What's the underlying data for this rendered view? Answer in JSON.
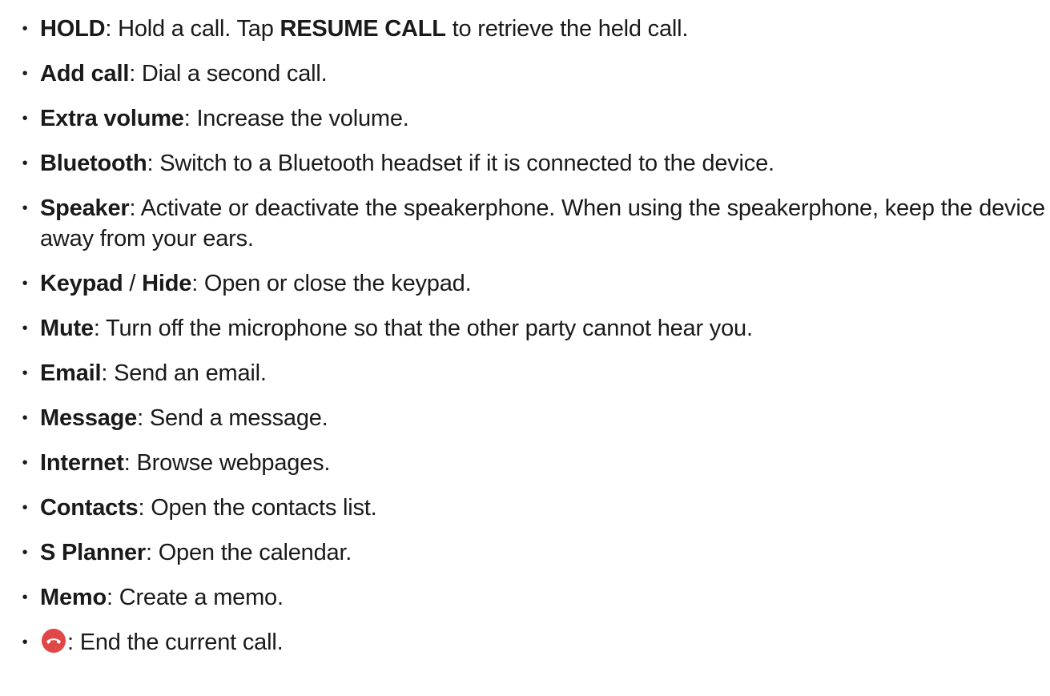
{
  "items": [
    {
      "term": "HOLD",
      "sep": ": Hold a call. Tap ",
      "term2": "RESUME CALL",
      "rest": " to retrieve the held call."
    },
    {
      "term": "Add call",
      "rest": ": Dial a second call."
    },
    {
      "term": "Extra volume",
      "rest": ": Increase the volume."
    },
    {
      "term": "Bluetooth",
      "rest": ": Switch to a Bluetooth headset if it is connected to the device."
    },
    {
      "term": "Speaker",
      "rest": ": Activate or deactivate the speakerphone. When using the speakerphone, keep the device away from your ears."
    },
    {
      "term": "Keypad",
      "sep": " / ",
      "term2": "Hide",
      "rest": ": Open or close the keypad."
    },
    {
      "term": "Mute",
      "rest": ": Turn off the microphone so that the other party cannot hear you."
    },
    {
      "term": "Email",
      "rest": ": Send an email."
    },
    {
      "term": "Message",
      "rest": ": Send a message."
    },
    {
      "term": "Internet",
      "rest": ": Browse webpages."
    },
    {
      "term": "Contacts",
      "rest": ": Open the contacts list."
    },
    {
      "term": "S Planner",
      "rest": ": Open the calendar."
    },
    {
      "term": "Memo",
      "rest": ": Create a memo."
    },
    {
      "icon": "end-call-icon",
      "rest": ": End the current call."
    }
  ],
  "colors": {
    "text": "#1a1a1a",
    "end_call_icon": "#e04848"
  }
}
